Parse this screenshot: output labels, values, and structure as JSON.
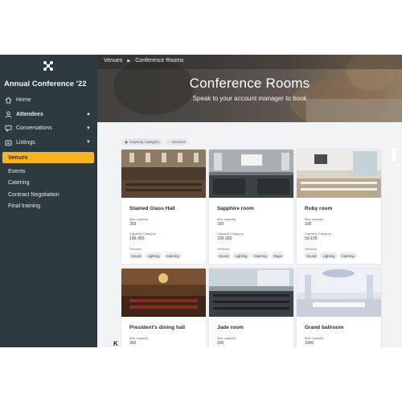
{
  "app": {
    "title": "Annual Conference '22"
  },
  "sidebar": {
    "items": [
      {
        "label": "Home",
        "icon": "home-icon",
        "chevron": ""
      },
      {
        "label": "Attendees",
        "icon": "person-icon",
        "chevron": "▲"
      },
      {
        "label": "Conversations",
        "icon": "chat-icon",
        "chevron": "▼"
      },
      {
        "label": "Listings",
        "icon": "listings-icon",
        "chevron": "▼"
      }
    ],
    "sub_items": [
      {
        "label": "Venues",
        "active": true
      },
      {
        "label": "Events",
        "active": false
      },
      {
        "label": "Catering",
        "active": false
      },
      {
        "label": "Contract Negotiation",
        "active": false
      },
      {
        "label": "Final training",
        "active": false
      }
    ]
  },
  "breadcrumb": {
    "items": [
      "Venues",
      "Conference Rooms"
    ],
    "separator": "▶"
  },
  "hero": {
    "title": "Conference Rooms",
    "subtitle": "Speak to your account manager to book"
  },
  "filters": [
    {
      "label": "Capacity Category"
    },
    {
      "label": "Services"
    }
  ],
  "labels": {
    "max_capacity": "Max capacity",
    "capacity_category": "Capacity Category",
    "services": "Services"
  },
  "rooms": [
    {
      "name": "Stained Glass Hall",
      "max_capacity": "250",
      "capacity_category": "100-300",
      "services": [
        "Sound",
        "Lighting",
        "Catering"
      ]
    },
    {
      "name": "Sapphire room",
      "max_capacity": "150",
      "capacity_category": "100-300",
      "services": [
        "Sound",
        "Lighting",
        "Catering",
        "Stage"
      ]
    },
    {
      "name": "Ruby room",
      "max_capacity": "100",
      "capacity_category": "50-100",
      "services": [
        "Sound",
        "Lighting",
        "Catering"
      ]
    },
    {
      "name": "President's dining hall",
      "max_capacity": "350",
      "capacity_category": "",
      "services": []
    },
    {
      "name": "Jade room",
      "max_capacity": "200",
      "capacity_category": "",
      "services": []
    },
    {
      "name": "Grand ballroom",
      "max_capacity": "1000",
      "capacity_category": "",
      "services": []
    }
  ],
  "stray_text": "K",
  "colors": {
    "sidebar": "#2d3a3f",
    "accent": "#f7b322",
    "main_bg": "#f2f3f5"
  }
}
